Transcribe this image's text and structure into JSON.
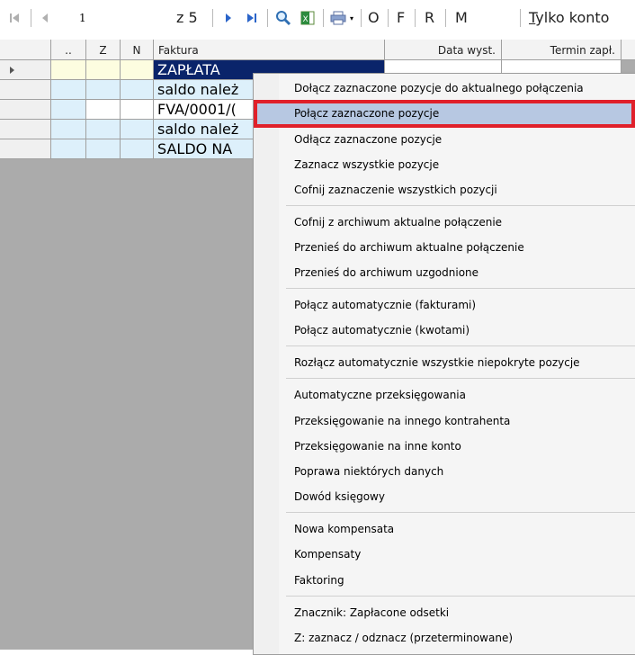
{
  "toolbar": {
    "record_number": "1",
    "of_label": "z 5",
    "filter_letters": [
      "O",
      "F",
      "R",
      "M"
    ],
    "tylko_label_prefix": "T",
    "tylko_label_rest": "ylko konto"
  },
  "grid": {
    "headers": {
      "dots": "..",
      "z": "Z",
      "n": "N",
      "faktura": "Faktura",
      "data_wyst": "Data wyst.",
      "termin_zapl": "Termin zapł."
    },
    "rows": [
      {
        "faktura": "ZAPŁATA"
      },
      {
        "faktura": "saldo należ"
      },
      {
        "faktura": "FVA/0001/("
      },
      {
        "faktura": "saldo należ"
      },
      {
        "faktura": "SALDO NA"
      }
    ]
  },
  "context_menu": {
    "items": [
      "Dołącz zaznaczone pozycje do aktualnego połączenia",
      "Połącz zaznaczone pozycje",
      "Odłącz zaznaczone pozycje",
      "Zaznacz wszystkie pozycje",
      "Cofnij zaznaczenie wszystkich pozycji",
      "Cofnij z archiwum aktualne połączenie",
      "Przenieś do archiwum aktualne połączenie",
      "Przenieś do archiwum uzgodnione",
      "Połącz automatycznie (fakturami)",
      "Połącz automatycznie (kwotami)",
      "Rozłącz automatycznie wszystkie niepokryte pozycje",
      "Automatyczne przeksięgowania",
      "Przeksięgowanie na innego kontrahenta",
      "Przeksięgowanie na inne konto",
      "Poprawa niektórych danych",
      "Dowód księgowy",
      "Nowa kompensata",
      "Kompensaty",
      "Faktoring",
      "Znacznik: Zapłacone odsetki",
      "Z: zaznacz / odznacz  (przeterminowane)"
    ]
  }
}
